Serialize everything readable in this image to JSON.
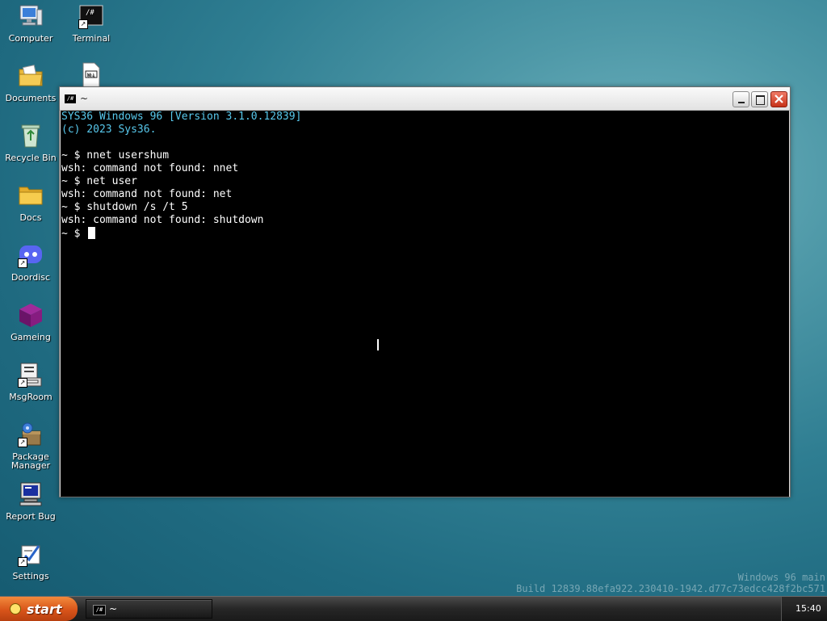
{
  "desktop": {
    "icons": [
      {
        "label": "Computer",
        "icon": "computer-icon"
      },
      {
        "label": "Terminal",
        "icon": "terminal-icon"
      },
      {
        "label": "Documents",
        "icon": "documents-icon"
      },
      {
        "label": "",
        "icon": "markdown-file-icon"
      },
      {
        "label": "Recycle Bin",
        "icon": "recycle-bin-icon"
      },
      {
        "label": "Docs",
        "icon": "folder-icon"
      },
      {
        "label": "Doordisc",
        "icon": "doordisc-icon"
      },
      {
        "label": "Gameing",
        "icon": "gameing-icon"
      },
      {
        "label": "MsgRoom",
        "icon": "msgroom-icon"
      },
      {
        "label": "Package Manager",
        "icon": "package-manager-icon"
      },
      {
        "label": "Report Bug",
        "icon": "report-bug-icon"
      },
      {
        "label": "Settings",
        "icon": "settings-icon"
      }
    ],
    "watermark": {
      "line1": "Windows 96 main",
      "line2": "Build 12839.88efa922.230410-1942.d77c73edcc428f2bc571"
    }
  },
  "window": {
    "title": "~",
    "icon_text": "/#",
    "colors": {
      "banner": "#58c8ec",
      "background": "#000000",
      "text": "#ffffff"
    },
    "terminal": {
      "banner": [
        "SYS36 Windows 96 [Version 3.1.0.12839]",
        "(c) 2023 Sys36."
      ],
      "lines": [
        "",
        "~ $ nnet usershum",
        "wsh: command not found: nnet",
        "~ $ net user",
        "wsh: command not found: net",
        "~ $ shutdown /s /t 5",
        "wsh: command not found: shutdown"
      ],
      "prompt": "~ $ "
    }
  },
  "taskbar": {
    "start_label": "start",
    "tasks": [
      {
        "label": "~",
        "icon_text": "/#"
      }
    ],
    "clock": "15:40"
  }
}
